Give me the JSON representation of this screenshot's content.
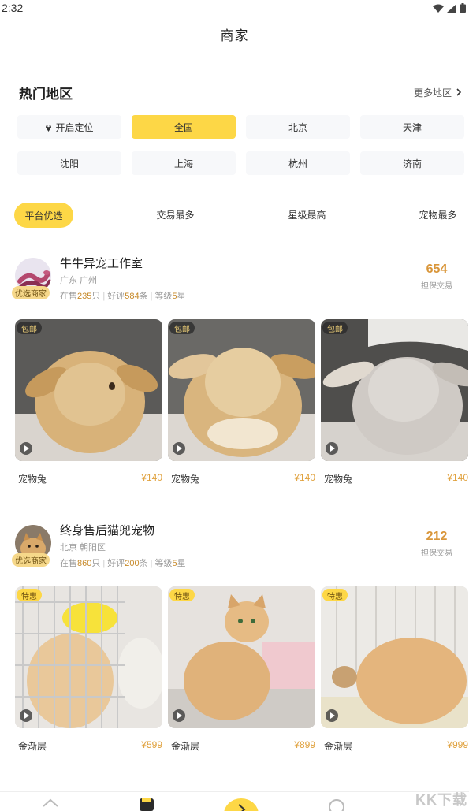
{
  "status_bar": {
    "time": "2:32"
  },
  "header": {
    "title": "商家"
  },
  "region": {
    "title": "热门地区",
    "more": "更多地区",
    "chips": [
      {
        "label": "开启定位",
        "icon": "location-pin-icon"
      },
      {
        "label": "全国",
        "active": true
      },
      {
        "label": "北京"
      },
      {
        "label": "天津"
      },
      {
        "label": "沈阳"
      },
      {
        "label": "上海"
      },
      {
        "label": "杭州"
      },
      {
        "label": "济南"
      }
    ]
  },
  "sort": {
    "items": [
      "平台优选",
      "交易最多",
      "星级最高",
      "宠物最多"
    ]
  },
  "merchants": [
    {
      "name": "牛牛异宠工作室",
      "tag": "优选商家",
      "location": "广东 广州",
      "stats": {
        "on_sale_prefix": "在售",
        "on_sale": "235",
        "on_sale_unit": "只",
        "reviews_prefix": "好评",
        "reviews": "584",
        "reviews_unit": "条",
        "level_prefix": "等级",
        "level": "5",
        "level_unit": "星"
      },
      "count_value": "654",
      "count_label": "担保交易",
      "products": [
        {
          "badge": "包邮",
          "name": "宠物兔",
          "price": "¥140"
        },
        {
          "badge": "包邮",
          "name": "宠物兔",
          "price": "¥140"
        },
        {
          "badge": "包邮",
          "name": "宠物兔",
          "price": "¥140"
        }
      ]
    },
    {
      "name": "终身售后猫兜宠物",
      "tag": "优选商家",
      "location": "北京 朝阳区",
      "stats": {
        "on_sale_prefix": "在售",
        "on_sale": "860",
        "on_sale_unit": "只",
        "reviews_prefix": "好评",
        "reviews": "200",
        "reviews_unit": "条",
        "level_prefix": "等级",
        "level": "5",
        "level_unit": "星"
      },
      "count_value": "212",
      "count_label": "担保交易",
      "products": [
        {
          "badge": "特惠",
          "name": "金渐层",
          "price": "¥599"
        },
        {
          "badge": "特惠",
          "name": "金渐层",
          "price": "¥899"
        },
        {
          "badge": "特惠",
          "name": "金渐层",
          "price": "¥999"
        }
      ]
    }
  ],
  "colors": {
    "accent": "#fdd746",
    "price": "#e0a23f"
  },
  "watermark": "KK下载"
}
